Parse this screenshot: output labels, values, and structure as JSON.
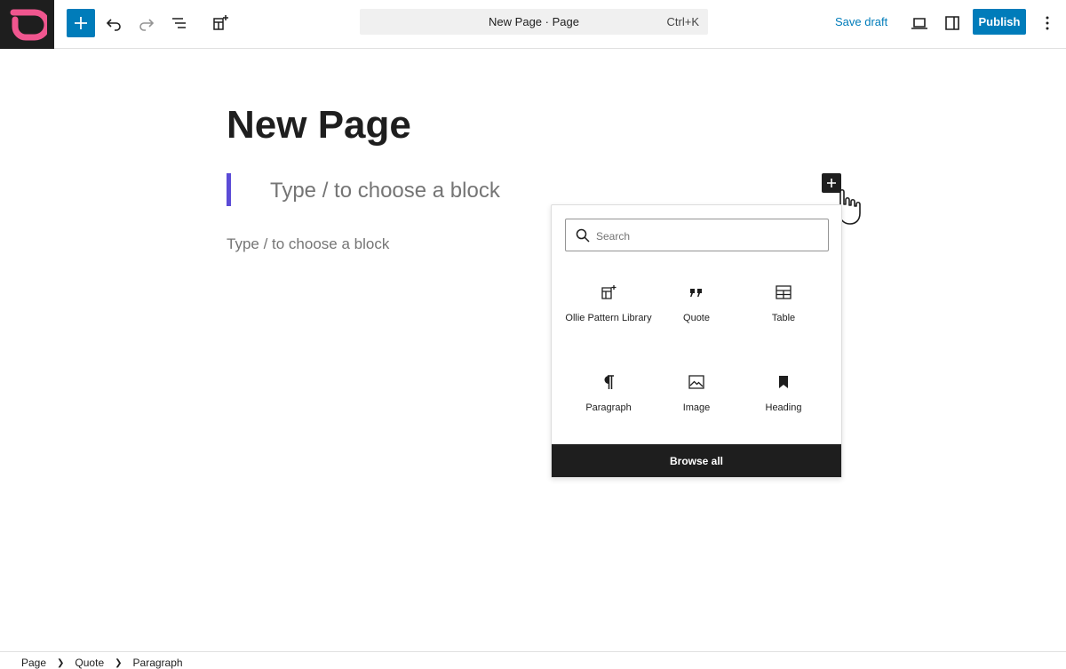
{
  "toolbar": {
    "document_title": "New Page · Page",
    "shortcut": "Ctrl+K",
    "save_draft": "Save draft",
    "publish": "Publish"
  },
  "editor": {
    "title": "New Page",
    "quote_placeholder": "Type / to choose a block",
    "paragraph_placeholder": "Type / to choose a block"
  },
  "inserter": {
    "search_placeholder": "Search",
    "blocks": [
      {
        "label": "Ollie Pattern Library",
        "icon": "pattern-library-icon"
      },
      {
        "label": "Quote",
        "icon": "quote-icon"
      },
      {
        "label": "Table",
        "icon": "table-icon"
      },
      {
        "label": "Paragraph",
        "icon": "paragraph-icon"
      },
      {
        "label": "Image",
        "icon": "image-icon"
      },
      {
        "label": "Heading",
        "icon": "heading-icon"
      }
    ],
    "browse_all": "Browse all"
  },
  "breadcrumb": [
    "Page",
    "Quote",
    "Paragraph"
  ],
  "colors": {
    "accent": "#007cba",
    "quote_border": "#5b4bd6",
    "logo_pink": "#f0568f",
    "dark": "#1e1e1e"
  }
}
